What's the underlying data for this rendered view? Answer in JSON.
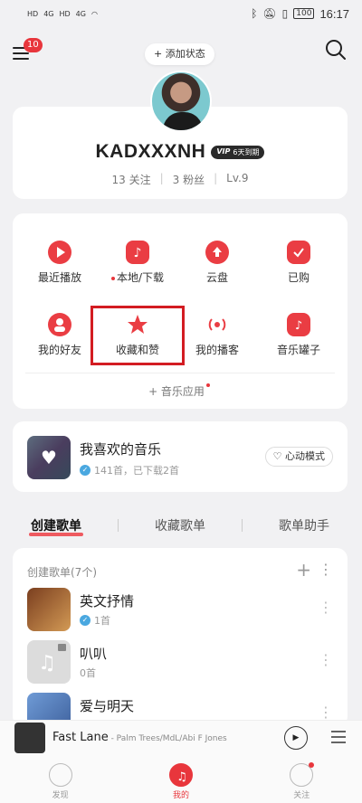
{
  "status_bar": {
    "left_icons": [
      "HD",
      "4G",
      "HD",
      "4G",
      "wifi-icon"
    ],
    "right_icons": [
      "bluetooth-icon",
      "mute-icon",
      "vibrate-icon"
    ],
    "battery": "100",
    "time": "16:17"
  },
  "top_bar": {
    "menu_badge": "10",
    "add_status": "+ 添加状态"
  },
  "profile": {
    "username": "KADXXXNH",
    "vip_mark": "VIP",
    "vip_text": "6天到期",
    "follow": "13 关注",
    "fans": "3 粉丝",
    "level": "Lv.9"
  },
  "grid": [
    {
      "label": "最近播放",
      "icon": "play-icon",
      "dot": false
    },
    {
      "label": "本地/下载",
      "icon": "music-note-icon",
      "dot": true
    },
    {
      "label": "云盘",
      "icon": "cloud-upload-icon",
      "dot": false
    },
    {
      "label": "已购",
      "icon": "shopping-bag-icon",
      "dot": false
    },
    {
      "label": "我的好友",
      "icon": "friends-icon",
      "dot": false
    },
    {
      "label": "收藏和赞",
      "icon": "star-icon",
      "dot": false
    },
    {
      "label": "我的播客",
      "icon": "broadcast-icon",
      "dot": false
    },
    {
      "label": "音乐罐子",
      "icon": "music-jar-icon",
      "dot": false
    }
  ],
  "music_app": "+ 音乐应用",
  "favorites": {
    "title": "我喜欢的音乐",
    "subtitle": "141首，已下载2首",
    "heart_mode": "心动模式"
  },
  "tabs": [
    "创建歌单",
    "收藏歌单",
    "歌单助手"
  ],
  "playlists": {
    "header": "创建歌单(7个)",
    "items": [
      {
        "title": "英文抒情",
        "sub": "1首",
        "verified": true,
        "cover": "#6a3b22"
      },
      {
        "title": "叭叭",
        "sub": "0首",
        "verified": false,
        "cover": "#dddddd"
      },
      {
        "title": "爱与明天",
        "sub": "",
        "verified": false,
        "cover": "#5b86c6"
      }
    ]
  },
  "player": {
    "title": "Fast Lane",
    "artist": " - Palm Trees/MdL/Abi F Jones"
  },
  "bottom_nav": [
    {
      "label": "发现",
      "active": false,
      "dot": false
    },
    {
      "label": "我的",
      "active": true,
      "dot": false
    },
    {
      "label": "关注",
      "active": false,
      "dot": true
    }
  ],
  "colors": {
    "accent": "#e8363c",
    "highlight_box": "#d31c22"
  }
}
